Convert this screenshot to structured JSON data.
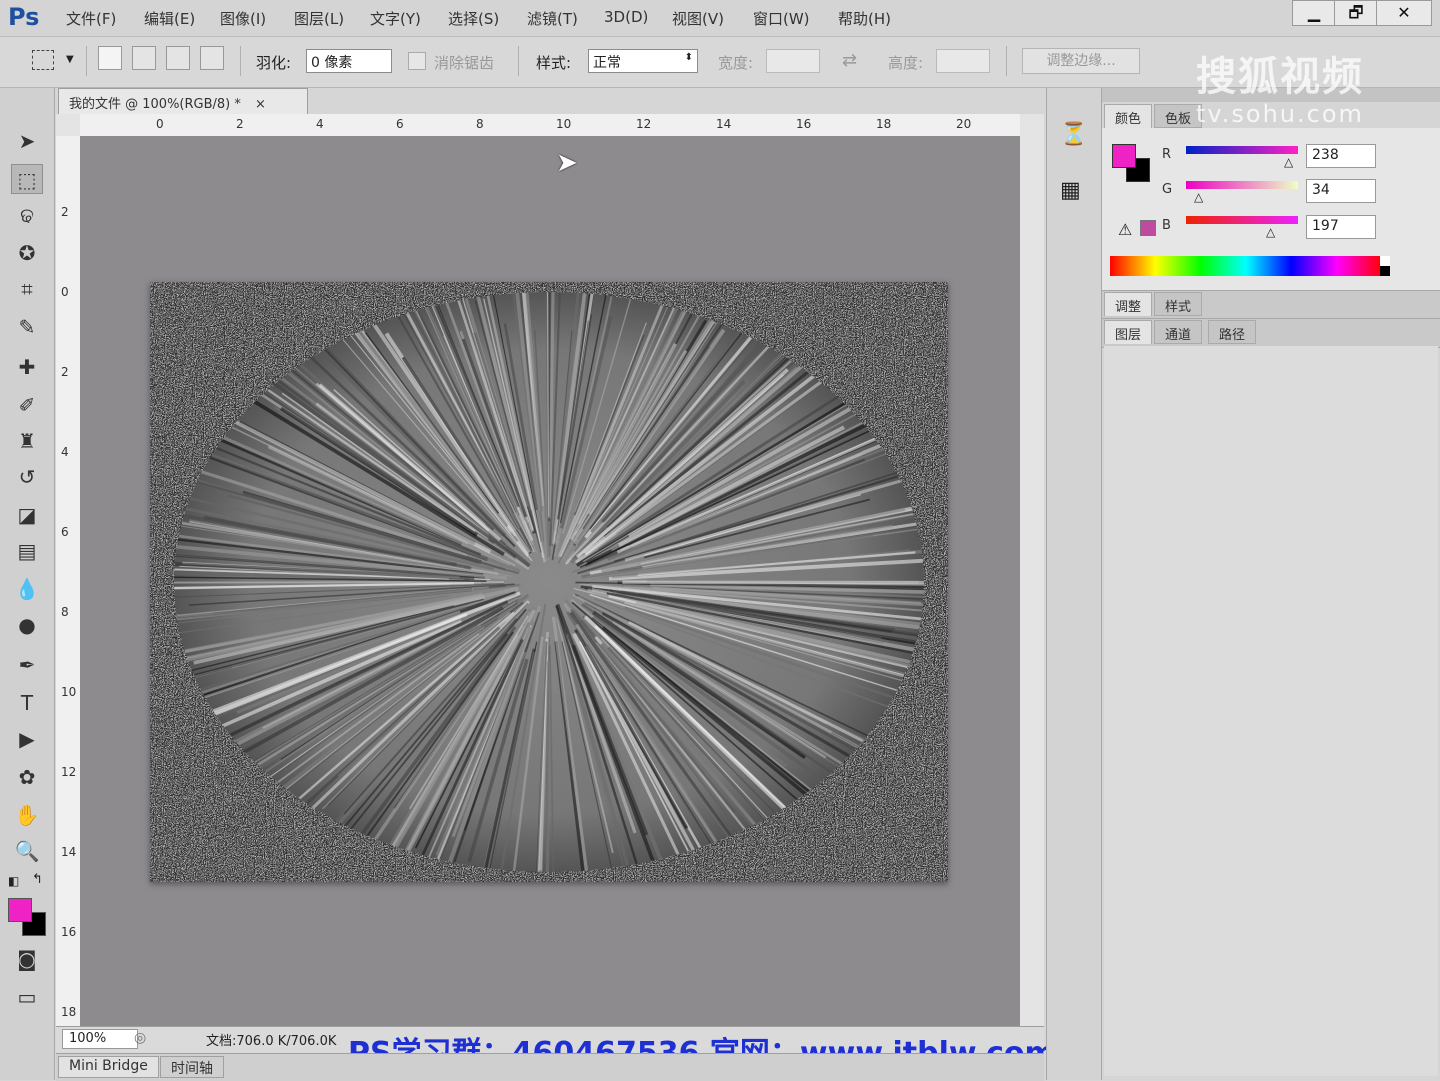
{
  "app": {
    "logo": "Ps"
  },
  "menu": [
    "文件(F)",
    "编辑(E)",
    "图像(I)",
    "图层(L)",
    "文字(Y)",
    "选择(S)",
    "滤镜(T)",
    "3D(D)",
    "视图(V)",
    "窗口(W)",
    "帮助(H)"
  ],
  "window_controls": {
    "minimize": "▁",
    "restore": "🗗",
    "close": "✕"
  },
  "options": {
    "feather_label": "羽化:",
    "feather_value": "0 像素",
    "antialias_label": "消除锯齿",
    "style_label": "样式:",
    "style_value": "正常",
    "width_label": "宽度:",
    "height_label": "高度:",
    "refine_edge": "调整边缘..."
  },
  "document": {
    "tab_title": "我的文件 @ 100%(RGB/8) *",
    "tab_close": "×",
    "ruler_h": [
      "0",
      "2",
      "4",
      "6",
      "8",
      "10",
      "12",
      "14",
      "16",
      "18",
      "20"
    ],
    "ruler_v": [
      "2",
      "0",
      "2",
      "4",
      "6",
      "8",
      "10",
      "12",
      "14",
      "16",
      "18"
    ]
  },
  "status": {
    "zoom": "100%",
    "doc_info": "文档:706.0 K/706.0K",
    "overlay_text": "PS学习群：460467536 官网：www.itblw.com"
  },
  "bottom_tabs": [
    "Mini Bridge",
    "时间轴"
  ],
  "color_panel": {
    "tabs": [
      "颜色",
      "色板"
    ],
    "channels": [
      {
        "name": "R",
        "value": "238"
      },
      {
        "name": "G",
        "value": "34"
      },
      {
        "name": "B",
        "value": "197"
      }
    ],
    "foreground": "#ee22c5",
    "background": "#000000"
  },
  "adjust_panel": {
    "tabs": [
      "调整",
      "样式"
    ]
  },
  "layers_panel": {
    "tabs": [
      "图层",
      "通道",
      "路径"
    ]
  },
  "watermark": {
    "logo": "搜狐视频",
    "url": "tv.sohu.com"
  },
  "tool_icons": [
    "move-icon",
    "marquee-icon",
    "lasso-icon",
    "quick-select-icon",
    "crop-icon",
    "eyedropper-icon",
    "healing-icon",
    "brush-icon",
    "stamp-icon",
    "history-brush-icon",
    "eraser-icon",
    "gradient-icon",
    "blur-icon",
    "dodge-icon",
    "pen-icon",
    "type-icon",
    "path-select-icon",
    "shape-icon",
    "hand-icon",
    "zoom-icon"
  ]
}
